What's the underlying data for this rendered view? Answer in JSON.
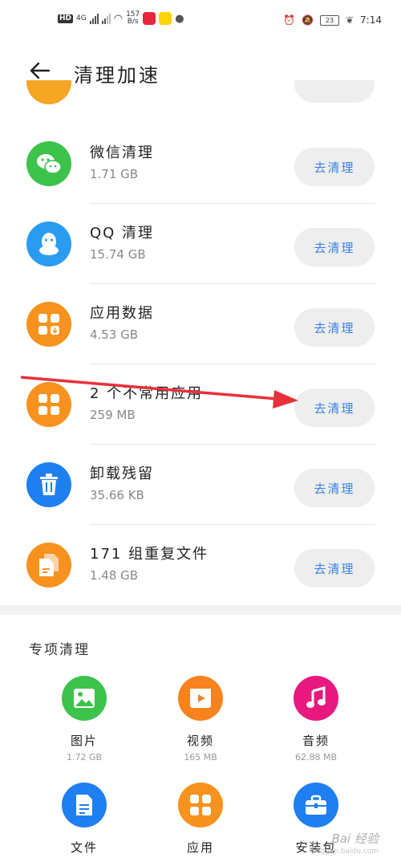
{
  "status_bar": {
    "network_badge": "HD",
    "network_type": "4G",
    "speed_value": "157",
    "speed_unit": "B/s",
    "battery_level": "23",
    "time": "7:14"
  },
  "header": {
    "title": "清理加速"
  },
  "clean_items": [
    {
      "name": "微信清理",
      "size": "1.71 GB",
      "button": "去清理",
      "color": "#3dc24c",
      "icon": "wechat-icon"
    },
    {
      "name": "QQ 清理",
      "size": "15.74 GB",
      "button": "去清理",
      "color": "#2a9cf0",
      "icon": "qq-icon"
    },
    {
      "name": "应用数据",
      "size": "4.53 GB",
      "button": "去清理",
      "color": "#f7921e",
      "icon": "app-data-icon"
    },
    {
      "name": "2 个不常用应用",
      "size": "259 MB",
      "button": "去清理",
      "color": "#f7921e",
      "icon": "apps-grid-icon"
    },
    {
      "name": "卸载残留",
      "size": "35.66 KB",
      "button": "去清理",
      "color": "#1e7ff0",
      "icon": "trash-icon"
    },
    {
      "name": "171 组重复文件",
      "size": "1.48 GB",
      "button": "去清理",
      "color": "#f7921e",
      "icon": "duplicate-file-icon"
    }
  ],
  "special": {
    "title": "专项清理",
    "items": [
      {
        "label": "图片",
        "size": "1.72 GB",
        "color": "#3dc24c",
        "icon": "image-icon"
      },
      {
        "label": "视频",
        "size": "165 MB",
        "color": "#f7821e",
        "icon": "video-icon"
      },
      {
        "label": "音频",
        "size": "62.88 MB",
        "color": "#e8197e",
        "icon": "music-icon"
      },
      {
        "label": "文件",
        "size": "",
        "color": "#1e7ff0",
        "icon": "document-icon"
      },
      {
        "label": "应用",
        "size": "",
        "color": "#f7921e",
        "icon": "apps-icon"
      },
      {
        "label": "安装包",
        "size": "",
        "color": "#1e7ff0",
        "icon": "package-icon"
      }
    ]
  },
  "watermark": {
    "text": "Bai 经验",
    "sub": "jingyan.baidu.com"
  }
}
